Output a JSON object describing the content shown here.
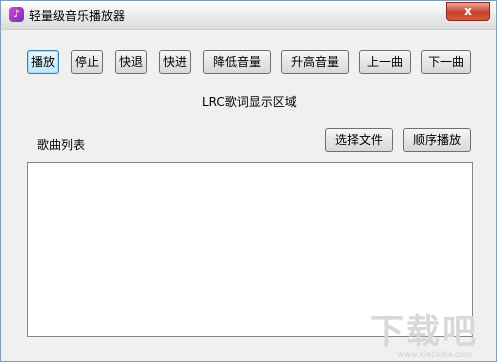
{
  "window": {
    "title": "轻量级音乐播放器",
    "icon": "music-note-icon",
    "close_label": "x"
  },
  "controls": [
    {
      "label": "播放",
      "name": "play-button"
    },
    {
      "label": "停止",
      "name": "stop-button"
    },
    {
      "label": "快退",
      "name": "rewind-button"
    },
    {
      "label": "快进",
      "name": "fast-forward-button"
    },
    {
      "label": "降低音量",
      "name": "volume-down-button"
    },
    {
      "label": "升高音量",
      "name": "volume-up-button"
    },
    {
      "label": "上一曲",
      "name": "previous-track-button"
    },
    {
      "label": "下一曲",
      "name": "next-track-button"
    }
  ],
  "lrc_area": {
    "text": "LRC歌词显示区域"
  },
  "playlist": {
    "label": "歌曲列表",
    "choose_file_label": "选择文件",
    "order_play_label": "顺序播放",
    "items": []
  },
  "watermark": {
    "text": "下载吧",
    "sub": "www.xiazaiba.com"
  }
}
